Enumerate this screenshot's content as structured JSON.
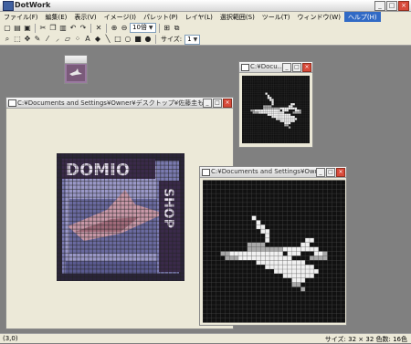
{
  "app": {
    "title": "DotWork",
    "controls": [
      "_",
      "□",
      "×"
    ]
  },
  "menu": [
    "ファイル(F)",
    "編集(E)",
    "表示(V)",
    "イメージ(I)",
    "パレット(P)",
    "レイヤ(L)",
    "選択範囲(S)",
    "ツール(T)",
    "ウィンドウ(W)",
    "ヘルプ(H)"
  ],
  "toolbar": {
    "zoom_value": "10倍",
    "size_label": "サイズ:",
    "size_value": "1"
  },
  "windows": {
    "thumb": {
      "title": ""
    },
    "small": {
      "title": "C:¥Docu..."
    },
    "main": {
      "title": "C:¥Documents and Settings¥Owner¥デスクトップ¥佐藤圭もこさん..."
    },
    "front": {
      "title": "C:¥Documents and Settings¥Own..."
    }
  },
  "status": {
    "left": "(3,0)",
    "right": "サイズ: 32 × 32  色数: 16色"
  },
  "colors": {
    "workspace": "#808080",
    "pixel_dark": "#111111",
    "pixel_light": "#f0f0f0",
    "pixel_mid": "#a8a8a8",
    "art_purple": "#6a5a8a",
    "art_pink": "#c898a8"
  }
}
